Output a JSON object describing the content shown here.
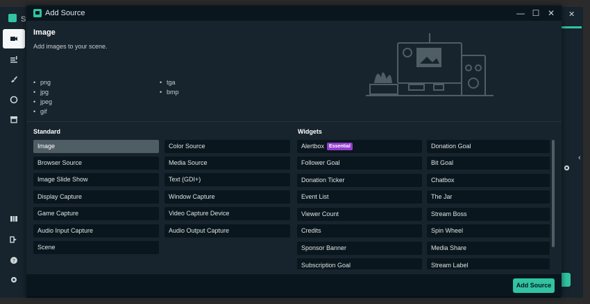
{
  "background": {
    "app_title": "St"
  },
  "dialog": {
    "title": "Add Source",
    "controls": {
      "minimize": "—",
      "maximize": "☐",
      "close": "✕"
    }
  },
  "info": {
    "title": "Image",
    "description": "Add images to your scene.",
    "formats_col1": [
      "png",
      "jpg",
      "jpeg",
      "gif"
    ],
    "formats_col2": [
      "tga",
      "bmp"
    ]
  },
  "standard": {
    "heading": "Standard",
    "col1": [
      "Image",
      "Browser Source",
      "Image Slide Show",
      "Display Capture",
      "Game Capture",
      "Audio Input Capture",
      "Scene"
    ],
    "col2": [
      "Color Source",
      "Media Source",
      "Text (GDI+)",
      "Window Capture",
      "Video Capture Device",
      "Audio Output Capture"
    ],
    "selected": "Image"
  },
  "widgets": {
    "heading": "Widgets",
    "col1": [
      "Alertbox",
      "Follower Goal",
      "Donation Ticker",
      "Event List",
      "Viewer Count",
      "Credits",
      "Sponsor Banner",
      "Subscription Goal"
    ],
    "col2": [
      "Donation Goal",
      "Bit Goal",
      "Chatbox",
      "The Jar",
      "Stream Boss",
      "Spin Wheel",
      "Media Share",
      "Stream Label"
    ],
    "alertbox_badge": "Essential"
  },
  "footer": {
    "add_button": "Add Source"
  },
  "colors": {
    "accent": "#31c3a2",
    "badge": "#953cd0",
    "selected": "#4f5e65",
    "item_bg": "#09161d",
    "panel_bg": "#17242d"
  }
}
